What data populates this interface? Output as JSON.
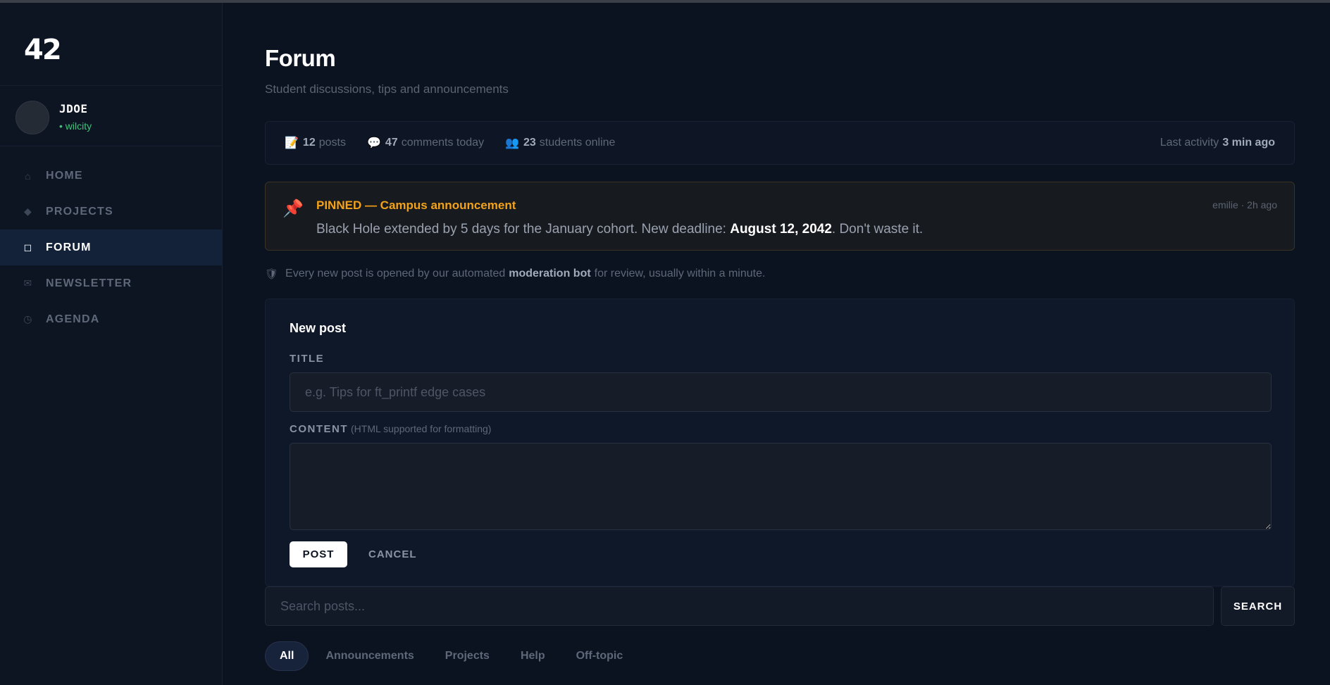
{
  "logo": "42",
  "user": {
    "login": "JDOE",
    "campus": "• wilcity"
  },
  "nav": [
    {
      "icon": "⌂",
      "icon_name": "home-icon",
      "label": "HOME"
    },
    {
      "icon": "◆",
      "icon_name": "diamond-icon",
      "label": "PROJECTS"
    },
    {
      "icon": "◻",
      "icon_name": "square-icon",
      "label": "FORUM",
      "active": true
    },
    {
      "icon": "✉",
      "icon_name": "envelope-icon",
      "label": "NEWSLETTER"
    },
    {
      "icon": "◷",
      "icon_name": "clock-icon",
      "label": "AGENDA"
    }
  ],
  "page": {
    "title": "Forum",
    "subtitle": "Student discussions, tips and announcements"
  },
  "stats": {
    "posts_icon": "📝",
    "posts_count": "12",
    "posts_label": "posts",
    "comments_icon": "💬",
    "comments_count": "47",
    "comments_label": "comments today",
    "online_icon": "👥",
    "online_count": "23",
    "online_label": "students online",
    "last_label": "Last activity",
    "last_value": "3 min ago"
  },
  "pinned": {
    "icon": "📌",
    "title": "PINNED — Campus announcement",
    "meta": "emilie · 2h ago",
    "body_before": "Black Hole extended by 5 days for the January cohort. New deadline: ",
    "body_bold": "August 12, 2042",
    "body_after": ". Don't waste it."
  },
  "moderation": {
    "icon": "🛡",
    "before": "Every new post is opened by our automated",
    "bold": "moderation bot",
    "after": "for review, usually within a minute."
  },
  "new_post": {
    "heading": "New post",
    "title_label": "TITLE",
    "title_placeholder": "e.g. Tips for ft_printf edge cases",
    "title_value": "",
    "content_label": "CONTENT",
    "content_hint": "(HTML supported for formatting)",
    "content_value": "",
    "post_button": "POST",
    "cancel_button": "CANCEL"
  },
  "search": {
    "placeholder": "Search posts...",
    "value": "",
    "button": "SEARCH"
  },
  "filters": [
    {
      "label": "All",
      "active": true
    },
    {
      "label": "Announcements"
    },
    {
      "label": "Projects"
    },
    {
      "label": "Help"
    },
    {
      "label": "Off-topic"
    }
  ],
  "colors": {
    "accent_pinned": "#f3a21a",
    "online_green": "#3ec47a",
    "background": "#0b1220"
  }
}
